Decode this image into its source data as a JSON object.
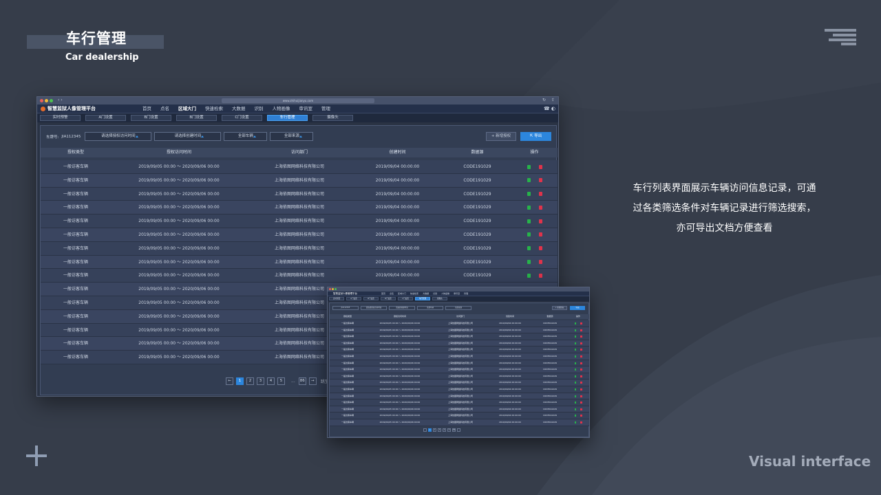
{
  "slide": {
    "title": "车行管理",
    "subtitle": "Car dealership",
    "description": "车行列表界面展示车辆访问信息记录，可通过各类筛选条件对车辆记录进行筛选搜索，亦可导出文档方便查看",
    "footer_label": "Visual interface",
    "icons": {
      "menu": "menu-lines-icon",
      "plus": "plus-icon"
    }
  },
  "app": {
    "url": "www.zhihuijianyu.com",
    "title": "智慧监狱人像管理平台",
    "nav": [
      "首页",
      "点名",
      "区域大门",
      "快速检索",
      "大数据",
      "识别",
      "人物画像",
      "审讯室",
      "管理"
    ],
    "active_nav": "区域大门",
    "tabs": [
      "实时预警",
      "A门设置",
      "B门设置",
      "B门设置",
      "C门设置",
      "车行管理",
      "摄像头"
    ],
    "active_tab": "车行管理",
    "filters": {
      "plate_label": "车牌号:",
      "plate_value": "JIA112345",
      "auth_time": "请选择授权访问时间",
      "created_time": "请选择创建时间",
      "vehicles": "全部车辆",
      "sources": "全部来源"
    },
    "buttons": {
      "add": "+ 新增授权",
      "export": "导出"
    },
    "columns": [
      "授权类型",
      "授权访问时间",
      "访问部门",
      "创建时间",
      "数据源",
      "操作"
    ],
    "rows": [
      [
        "一般访客车辆",
        "2019/09/05 00:00 ～ 2020/09/06 00:00",
        "上海依图网络科技有限公司",
        "2019/09/04 00:00:00",
        "CODE191029"
      ],
      [
        "一般访客车辆",
        "2019/09/05 00:00 ～ 2020/09/06 00:00",
        "上海依图网络科技有限公司",
        "2019/09/04 00:00:00",
        "CODE191029"
      ],
      [
        "一般访客车辆",
        "2019/09/05 00:00 ～ 2020/09/06 00:00",
        "上海依图网络科技有限公司",
        "2019/09/04 00:00:00",
        "CODE191029"
      ],
      [
        "一般访客车辆",
        "2019/09/05 00:00 ～ 2020/09/06 00:00",
        "上海依图网络科技有限公司",
        "2019/09/04 00:00:00",
        "CODE191029"
      ],
      [
        "一般访客车辆",
        "2019/09/05 00:00 ～ 2020/09/06 00:00",
        "上海依图网络科技有限公司",
        "2019/09/04 00:00:00",
        "CODE191029"
      ],
      [
        "一般访客车辆",
        "2019/09/05 00:00 ～ 2020/09/06 00:00",
        "上海依图网络科技有限公司",
        "2019/09/04 00:00:00",
        "CODE191029"
      ],
      [
        "一般访客车辆",
        "2019/09/05 00:00 ～ 2020/09/06 00:00",
        "上海依图网络科技有限公司",
        "2019/09/04 00:00:00",
        "CODE191029"
      ],
      [
        "一般访客车辆",
        "2019/09/05 00:00 ～ 2020/09/06 00:00",
        "上海依图网络科技有限公司",
        "2019/09/04 00:00:00",
        "CODE191029"
      ],
      [
        "一般访客车辆",
        "2019/09/05 00:00 ～ 2020/09/06 00:00",
        "上海依图网络科技有限公司",
        "2019/09/04 00:00:00",
        "CODE191029"
      ],
      [
        "一般访客车辆",
        "2019/09/05 00:00 ～ 2020/09/06 00:00",
        "上海依图网络科技有限公司",
        "",
        ""
      ],
      [
        "一般访客车辆",
        "2019/09/05 00:00 ～ 2020/09/06 00:00",
        "上海依图网络科技有限公司",
        "",
        ""
      ],
      [
        "一般访客车辆",
        "2019/09/05 00:00 ～ 2020/09/06 00:00",
        "上海依图网络科技有限公司",
        "",
        ""
      ],
      [
        "一般访客车辆",
        "2019/09/05 00:00 ～ 2020/09/06 00:00",
        "上海依图网络科技有限公司",
        "",
        ""
      ],
      [
        "一般访客车辆",
        "2019/09/05 00:00 ～ 2020/09/06 00:00",
        "上海依图网络科技有限公司",
        "",
        ""
      ],
      [
        "一般访客车辆",
        "2019/09/05 00:00 ～ 2020/09/06 00:00",
        "上海依图网络科技有限公司",
        "",
        ""
      ]
    ],
    "action_icons": {
      "edit": "document-edit-icon",
      "delete": "trash-delete-icon"
    },
    "colors": {
      "accent": "#2c86dd",
      "edit": "#27b34a",
      "delete": "#e0334b"
    },
    "pagination": {
      "pages": [
        "1",
        "2",
        "3",
        "4",
        "5"
      ],
      "current": "1",
      "ellipsis": "...",
      "last": "86",
      "jump_label": "跳至"
    }
  }
}
